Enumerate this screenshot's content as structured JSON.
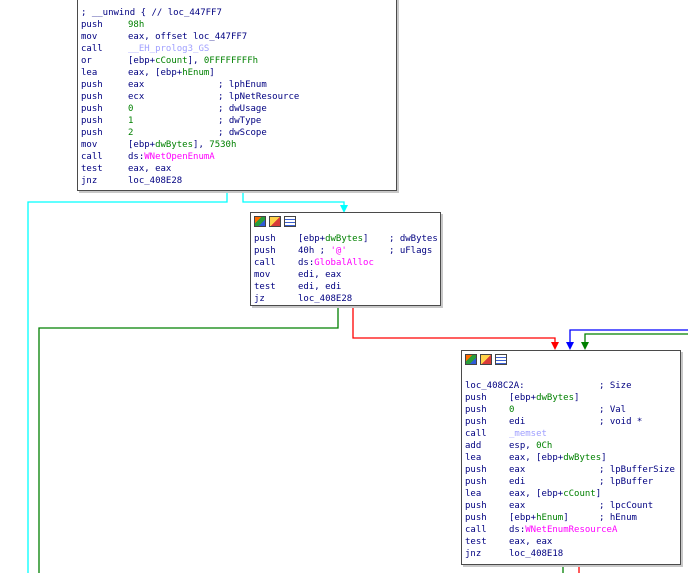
{
  "colors": {
    "cyan_edge": "#00ffff",
    "green_edge": "#008000",
    "red_edge": "#ff0000",
    "blue_edge": "#0000ff",
    "node_text": "#000080",
    "import_func": "#ff00ff",
    "local_var": "#008000",
    "library_func": "#a0a0ff"
  },
  "header_icons": [
    "graph-overview-icon",
    "edit-name-icon",
    "comment-icon"
  ],
  "block1": {
    "unwind": "; __unwind { // loc_447FF7",
    "l1_m": "push",
    "l1_o": "98h",
    "l2_m": "mov",
    "l2_o": "eax, offset loc_447FF7",
    "l3_m": "call",
    "l3_o": "__EH_prolog3_GS",
    "l4_m": "or",
    "l4_a": "[ebp+",
    "l4_v": "cCount",
    "l4_b": "], ",
    "l4_n": "0FFFFFFFFh",
    "l5_m": "lea",
    "l5_a": "eax, [ebp+",
    "l5_v": "hEnum",
    "l5_b": "]",
    "l6_m": "push",
    "l6_o": "eax",
    "l6_c": "; lphEnum",
    "l7_m": "push",
    "l7_o": "ecx",
    "l7_c": "; lpNetResource",
    "l8_m": "push",
    "l8_o": "0",
    "l8_c": "; dwUsage",
    "l9_m": "push",
    "l9_o": "1",
    "l9_c": "; dwType",
    "l10_m": "push",
    "l10_o": "2",
    "l10_c": "; dwScope",
    "l11_m": "mov",
    "l11_a": "[ebp+",
    "l11_v": "dwBytes",
    "l11_b": "], ",
    "l11_n": "7530h",
    "l12_m": "call",
    "l12_a": "ds:",
    "l12_f": "WNetOpenEnumA",
    "l13_m": "test",
    "l13_o": "eax, eax",
    "l14_m": "jnz",
    "l14_o": "loc_408E28"
  },
  "block2": {
    "l1_m": "push",
    "l1_a": "[ebp+",
    "l1_v": "dwBytes",
    "l1_b": "]",
    "l1_c": "; dwBytes",
    "l2_m": "push",
    "l2_a": "40h ; ",
    "l2_s": "'@'",
    "l2_c": "; uFlags",
    "l3_m": "call",
    "l3_a": "ds:",
    "l3_f": "GlobalAlloc",
    "l4_m": "mov",
    "l4_o": "edi, eax",
    "l5_m": "test",
    "l5_o": "edi, edi",
    "l6_m": "jz",
    "l6_o": "loc_408E28"
  },
  "block3": {
    "label": "loc_408C2A:",
    "label_c": "; Size",
    "l1_m": "push",
    "l1_a": "[ebp+",
    "l1_v": "dwBytes",
    "l1_b": "]",
    "l2_m": "push",
    "l2_o": "0",
    "l2_c": "; Val",
    "l3_m": "push",
    "l3_o": "edi",
    "l3_c": "; void *",
    "l4_m": "call",
    "l4_f": "_memset",
    "l5_m": "add",
    "l5_a": "esp, ",
    "l5_n": "0Ch",
    "l6_m": "lea",
    "l6_a": "eax, [ebp+",
    "l6_v": "dwBytes",
    "l6_b": "]",
    "l7_m": "push",
    "l7_o": "eax",
    "l7_c": "; lpBufferSize",
    "l8_m": "push",
    "l8_o": "edi",
    "l8_c": "; lpBuffer",
    "l9_m": "lea",
    "l9_a": "eax, [ebp+",
    "l9_v": "cCount",
    "l9_b": "]",
    "l10_m": "push",
    "l10_o": "eax",
    "l10_c": "; lpcCount",
    "l11_m": "push",
    "l11_a": "[ebp+",
    "l11_v": "hEnum",
    "l11_b": "]",
    "l11_c": "; hEnum",
    "l12_m": "call",
    "l12_a": "ds:",
    "l12_f": "WNetEnumResourceA",
    "l13_m": "test",
    "l13_o": "eax, eax",
    "l14_m": "jnz",
    "l14_o": "loc_408E18"
  }
}
